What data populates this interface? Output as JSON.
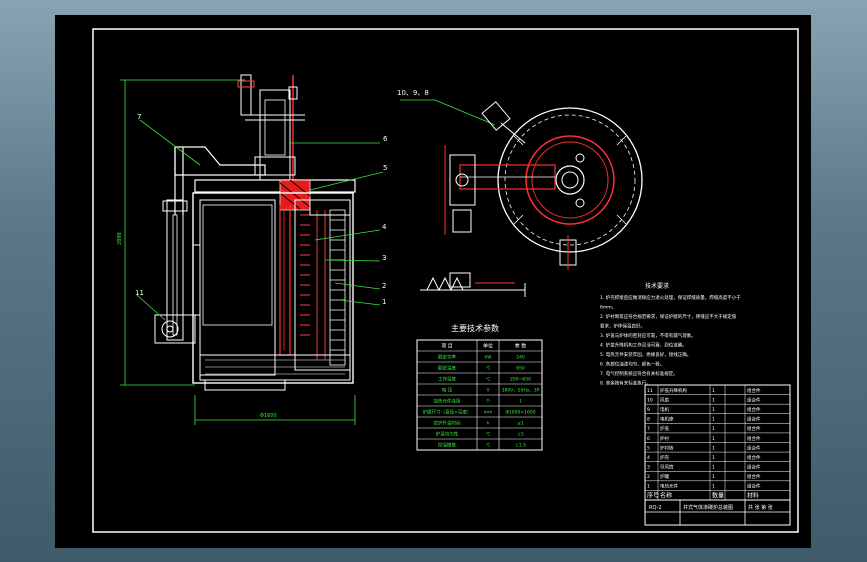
{
  "drawing": {
    "dimension_height": "2898",
    "dimension_width": "Φ1600",
    "callouts": [
      "1",
      "2",
      "3",
      "4",
      "5",
      "6",
      "7",
      "11",
      "10、9、8"
    ],
    "tech_table": {
      "title": "主要技术参数",
      "headers": [
        "项  目",
        "单位",
        "参  数"
      ],
      "rows": [
        [
          "额定功率",
          "kW",
          "240"
        ],
        [
          "额定温度",
          "℃",
          "650"
        ],
        [
          "工作温度",
          "℃",
          "200~650"
        ],
        [
          "电    压",
          "V",
          "380V，50Hz，3P"
        ],
        [
          "加热元件连接",
          "个",
          "1"
        ],
        [
          "炉膛尺寸（直径×深度）",
          "mm",
          "Φ1000×1600"
        ],
        [
          "空炉升温时间",
          "h",
          "≤1"
        ],
        [
          "炉温均匀性",
          "℃",
          "±5"
        ],
        [
          "控温精度",
          "℃",
          "±1.5"
        ]
      ]
    },
    "requirements": {
      "title": "技术要求",
      "lines": [
        "1. 炉壳焊接后应做消除应力退火处理，保证焊缝质量，焊缝高度不小于",
        "6mm。",
        "2. 炉衬砌筑应符合规范要求，保证炉膛的尺寸，砖缝应不大于规定值",
        "要求，炉体保温良好。",
        "3. 炉盖与炉体的密封应可靠，不得有漏气现象。",
        "4. 炉盖升降机构工作灵活可靠，到位准确。",
        "5. 电热元件安装牢固，绝缘良好，接线正确。",
        "6. 各部位油漆均匀，颜色一致。",
        "7. 电气控制系统应符合有关标准规定。",
        "8. 其余按有关标准执行。"
      ]
    },
    "parts": {
      "rows": [
        [
          "11",
          "炉盖升降机构",
          "1",
          "",
          "组合件"
        ],
        [
          "10",
          "风扇",
          "1",
          "",
          "组合件"
        ],
        [
          "9",
          "电机",
          "1",
          "",
          "组合件"
        ],
        [
          "8",
          "电机座",
          "1",
          "",
          "组合件"
        ],
        [
          "7",
          "炉盖",
          "1",
          "",
          "组合件"
        ],
        [
          "6",
          "炉衬",
          "1",
          "",
          "组合件"
        ],
        [
          "5",
          "炉衬砖",
          "1",
          "",
          "组合件"
        ],
        [
          "4",
          "炉壳",
          "1",
          "",
          "组合件"
        ],
        [
          "3",
          "导风筒",
          "1",
          "",
          "组合件"
        ],
        [
          "2",
          "炉罐",
          "1",
          "",
          "组合件"
        ],
        [
          "1",
          "电热元件",
          "1",
          "",
          "组合件"
        ]
      ],
      "headers": [
        "序号",
        "名称",
        "数量",
        "",
        "材料"
      ]
    },
    "title_block": {
      "drawing_no": "RQ-2",
      "name": "井式气体渗碳炉总装图",
      "sheet": "共  张  第  张"
    }
  }
}
